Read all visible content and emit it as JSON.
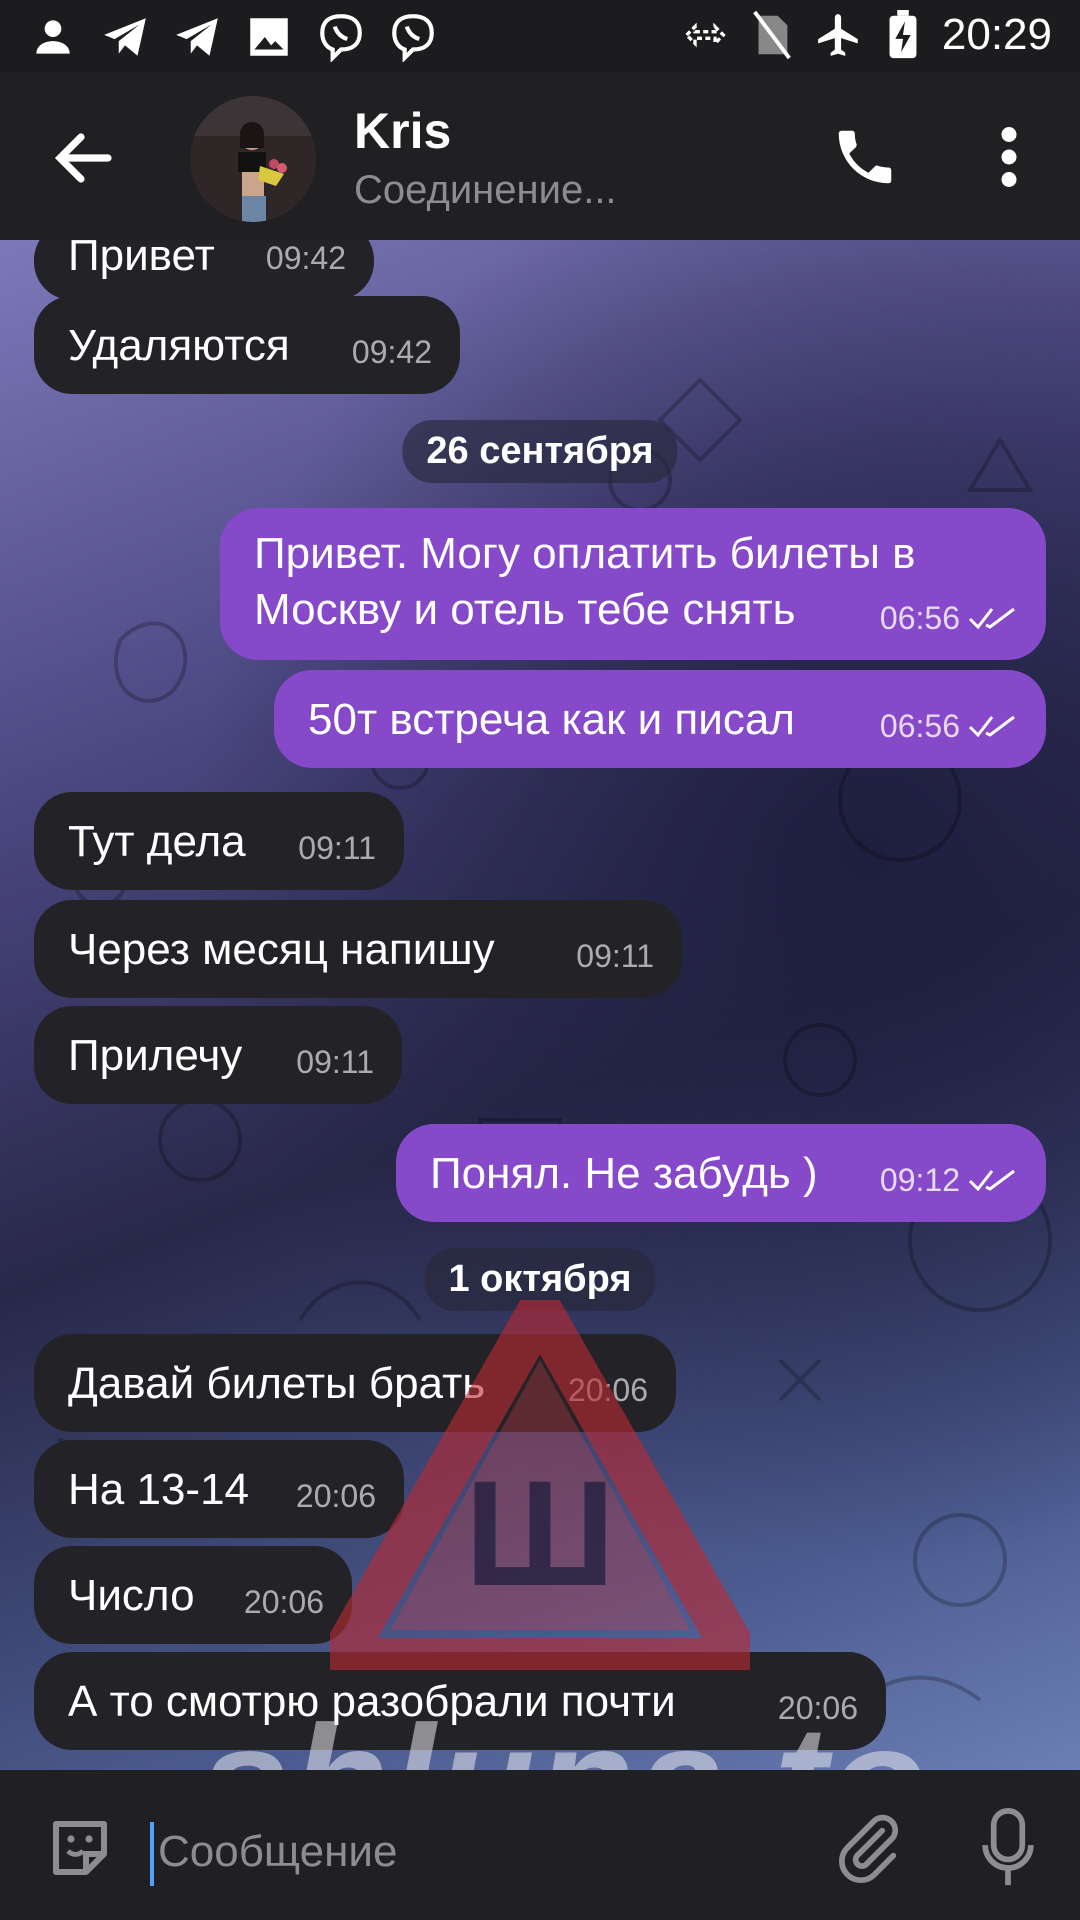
{
  "status_bar": {
    "time": "20:29"
  },
  "header": {
    "name": "Kris",
    "status": "Соединение..."
  },
  "messages": [
    {
      "dir": "in",
      "text": "Привет",
      "time": "09:42"
    },
    {
      "dir": "in",
      "text": "Удаляются",
      "time": "09:42"
    },
    {
      "date": "26 сентября"
    },
    {
      "dir": "out",
      "line1": "Привет. Могу оплатить билеты в",
      "line2": "Москву и отель тебе снять",
      "time": "06:56"
    },
    {
      "dir": "out",
      "text": "50т встреча как и писал",
      "time": "06:56"
    },
    {
      "dir": "in",
      "text": "Тут дела",
      "time": "09:11"
    },
    {
      "dir": "in",
      "text": "Через месяц напишу",
      "time": "09:11"
    },
    {
      "dir": "in",
      "text": "Прилечу",
      "time": "09:11"
    },
    {
      "dir": "out",
      "text": "Понял. Не забудь )",
      "time": "09:12"
    },
    {
      "date": "1 октября"
    },
    {
      "dir": "in",
      "text": "Давай билеты брать",
      "time": "20:06"
    },
    {
      "dir": "in",
      "text": "На 13-14",
      "time": "20:06"
    },
    {
      "dir": "in",
      "text": "Число",
      "time": "20:06"
    },
    {
      "dir": "in",
      "text": "А то смотрю разобрали почти",
      "time": "20:06"
    }
  ],
  "composer": {
    "placeholder": "Сообщение"
  },
  "watermark": {
    "text": "shluna.to",
    "letter": "Ш"
  },
  "colors": {
    "outgoing": "#8549c9",
    "incoming": "#232327",
    "accent": "#4ea3ff"
  }
}
